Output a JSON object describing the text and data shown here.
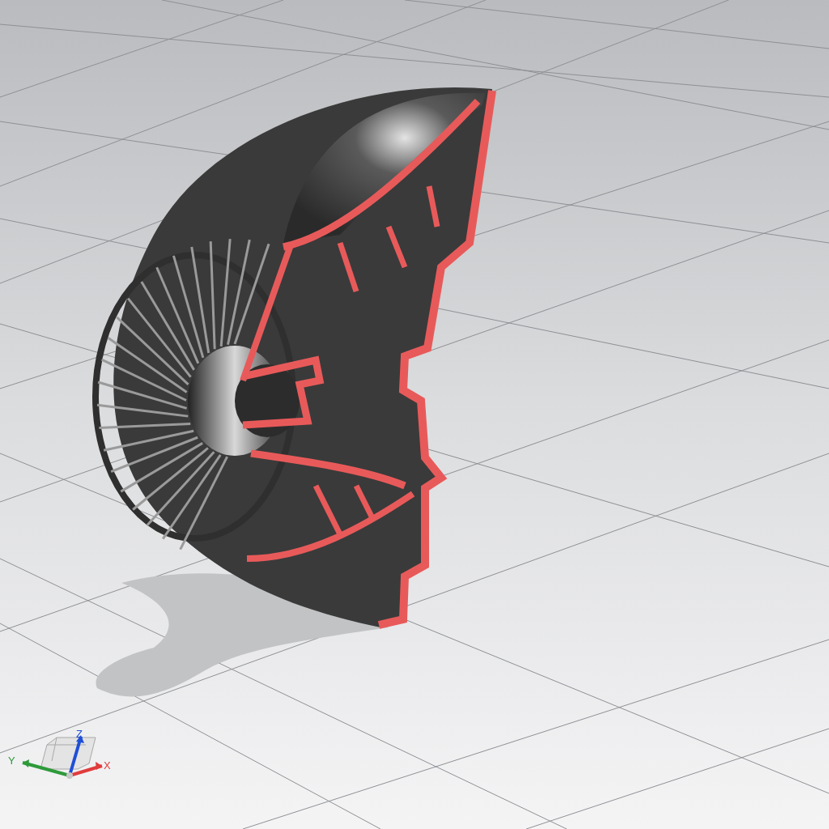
{
  "viewport": {
    "triad": {
      "axes": [
        {
          "kind": "x",
          "label": "X",
          "color": "#e03c3c"
        },
        {
          "kind": "y",
          "label": "Y",
          "color": "#2e9a3a"
        },
        {
          "kind": "z",
          "label": "Z",
          "color": "#1f4fd6"
        }
      ]
    }
  }
}
